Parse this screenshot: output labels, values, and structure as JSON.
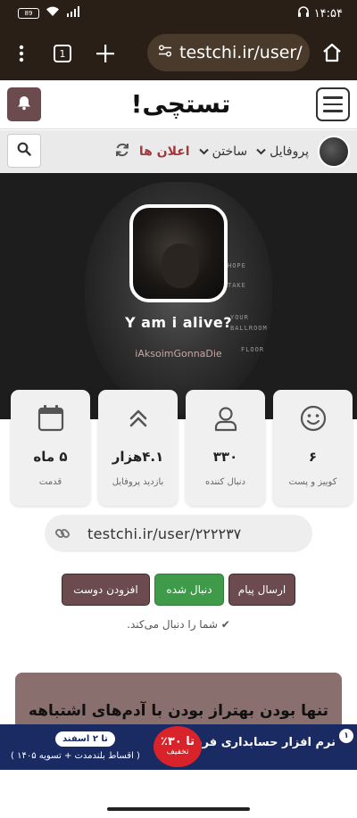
{
  "status_bar": {
    "battery": "89",
    "time": "۱۴:۵۴"
  },
  "browser": {
    "tab_count": "1",
    "url": "testchi.ir/user/"
  },
  "header": {
    "logo": "تستچی!"
  },
  "nav": {
    "items": [
      {
        "label": "پروفایل"
      },
      {
        "label": "ساختن"
      },
      {
        "label": "اعلان ها"
      }
    ]
  },
  "profile": {
    "name": "Y am i alive?",
    "subtitle": "iAksoimGonnaDie",
    "banner_words": [
      "HOPE",
      "TAKE",
      "YOUR",
      "BALLROOM",
      "FLOOR"
    ]
  },
  "stats": [
    {
      "value": "۶",
      "label": "کوییز و پست",
      "icon": "smile-icon"
    },
    {
      "value": "۳۳۰",
      "label": "دنبال کننده",
      "icon": "user-icon"
    },
    {
      "value": "۴.۱هزار",
      "label": "بازدید پروفایل",
      "icon": "chevrons-up-icon"
    },
    {
      "value": "۵ ماه",
      "label": "قدمت",
      "icon": "calendar-icon"
    }
  ],
  "profile_link": "testchi.ir/user/۲۲۲۲۳۷",
  "actions": {
    "message": "ارسال پیام",
    "following": "دنبال شده",
    "add_friend": "افزودن دوست"
  },
  "follows_you": "✔ شما را دنبال می‌کند.",
  "content_card": {
    "title": "تنها بودن بهتراز بودن با آدم‌های اشتباهه"
  },
  "ad": {
    "badge": "۱",
    "title": "نرم افزار حسابداری فرداد",
    "discount": "تا ۳۰٪",
    "discount_sub": "تخفیف",
    "date": "تا ۲ اسفند",
    "subtitle": "( اقساط بلندمدت + تسویه ۱۴۰۵ )"
  },
  "colors": {
    "accent": "#6b4b4d",
    "success": "#3f9b49",
    "notif": "#a0393c",
    "ad_bg": "#1a2a63"
  }
}
